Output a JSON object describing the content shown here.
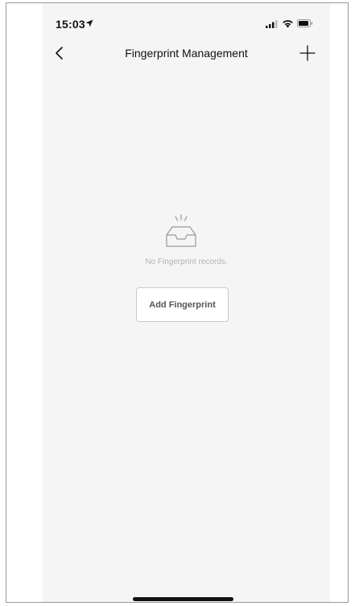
{
  "status_bar": {
    "time": "15:03",
    "icons": [
      "location-arrow-icon",
      "cellular-signal-icon",
      "wifi-icon",
      "battery-icon"
    ]
  },
  "nav": {
    "back_icon": "chevron-left-icon",
    "title": "Fingerprint Management",
    "add_icon": "plus-icon"
  },
  "empty_state": {
    "icon": "empty-inbox-icon",
    "message": "No Fingerprint records.",
    "button_label": "Add Fingerprint"
  },
  "colors": {
    "screen_background": "#f5f5f5",
    "text_primary": "#111111",
    "text_muted": "#b3b3b3",
    "button_border": "#c9c9c9"
  }
}
